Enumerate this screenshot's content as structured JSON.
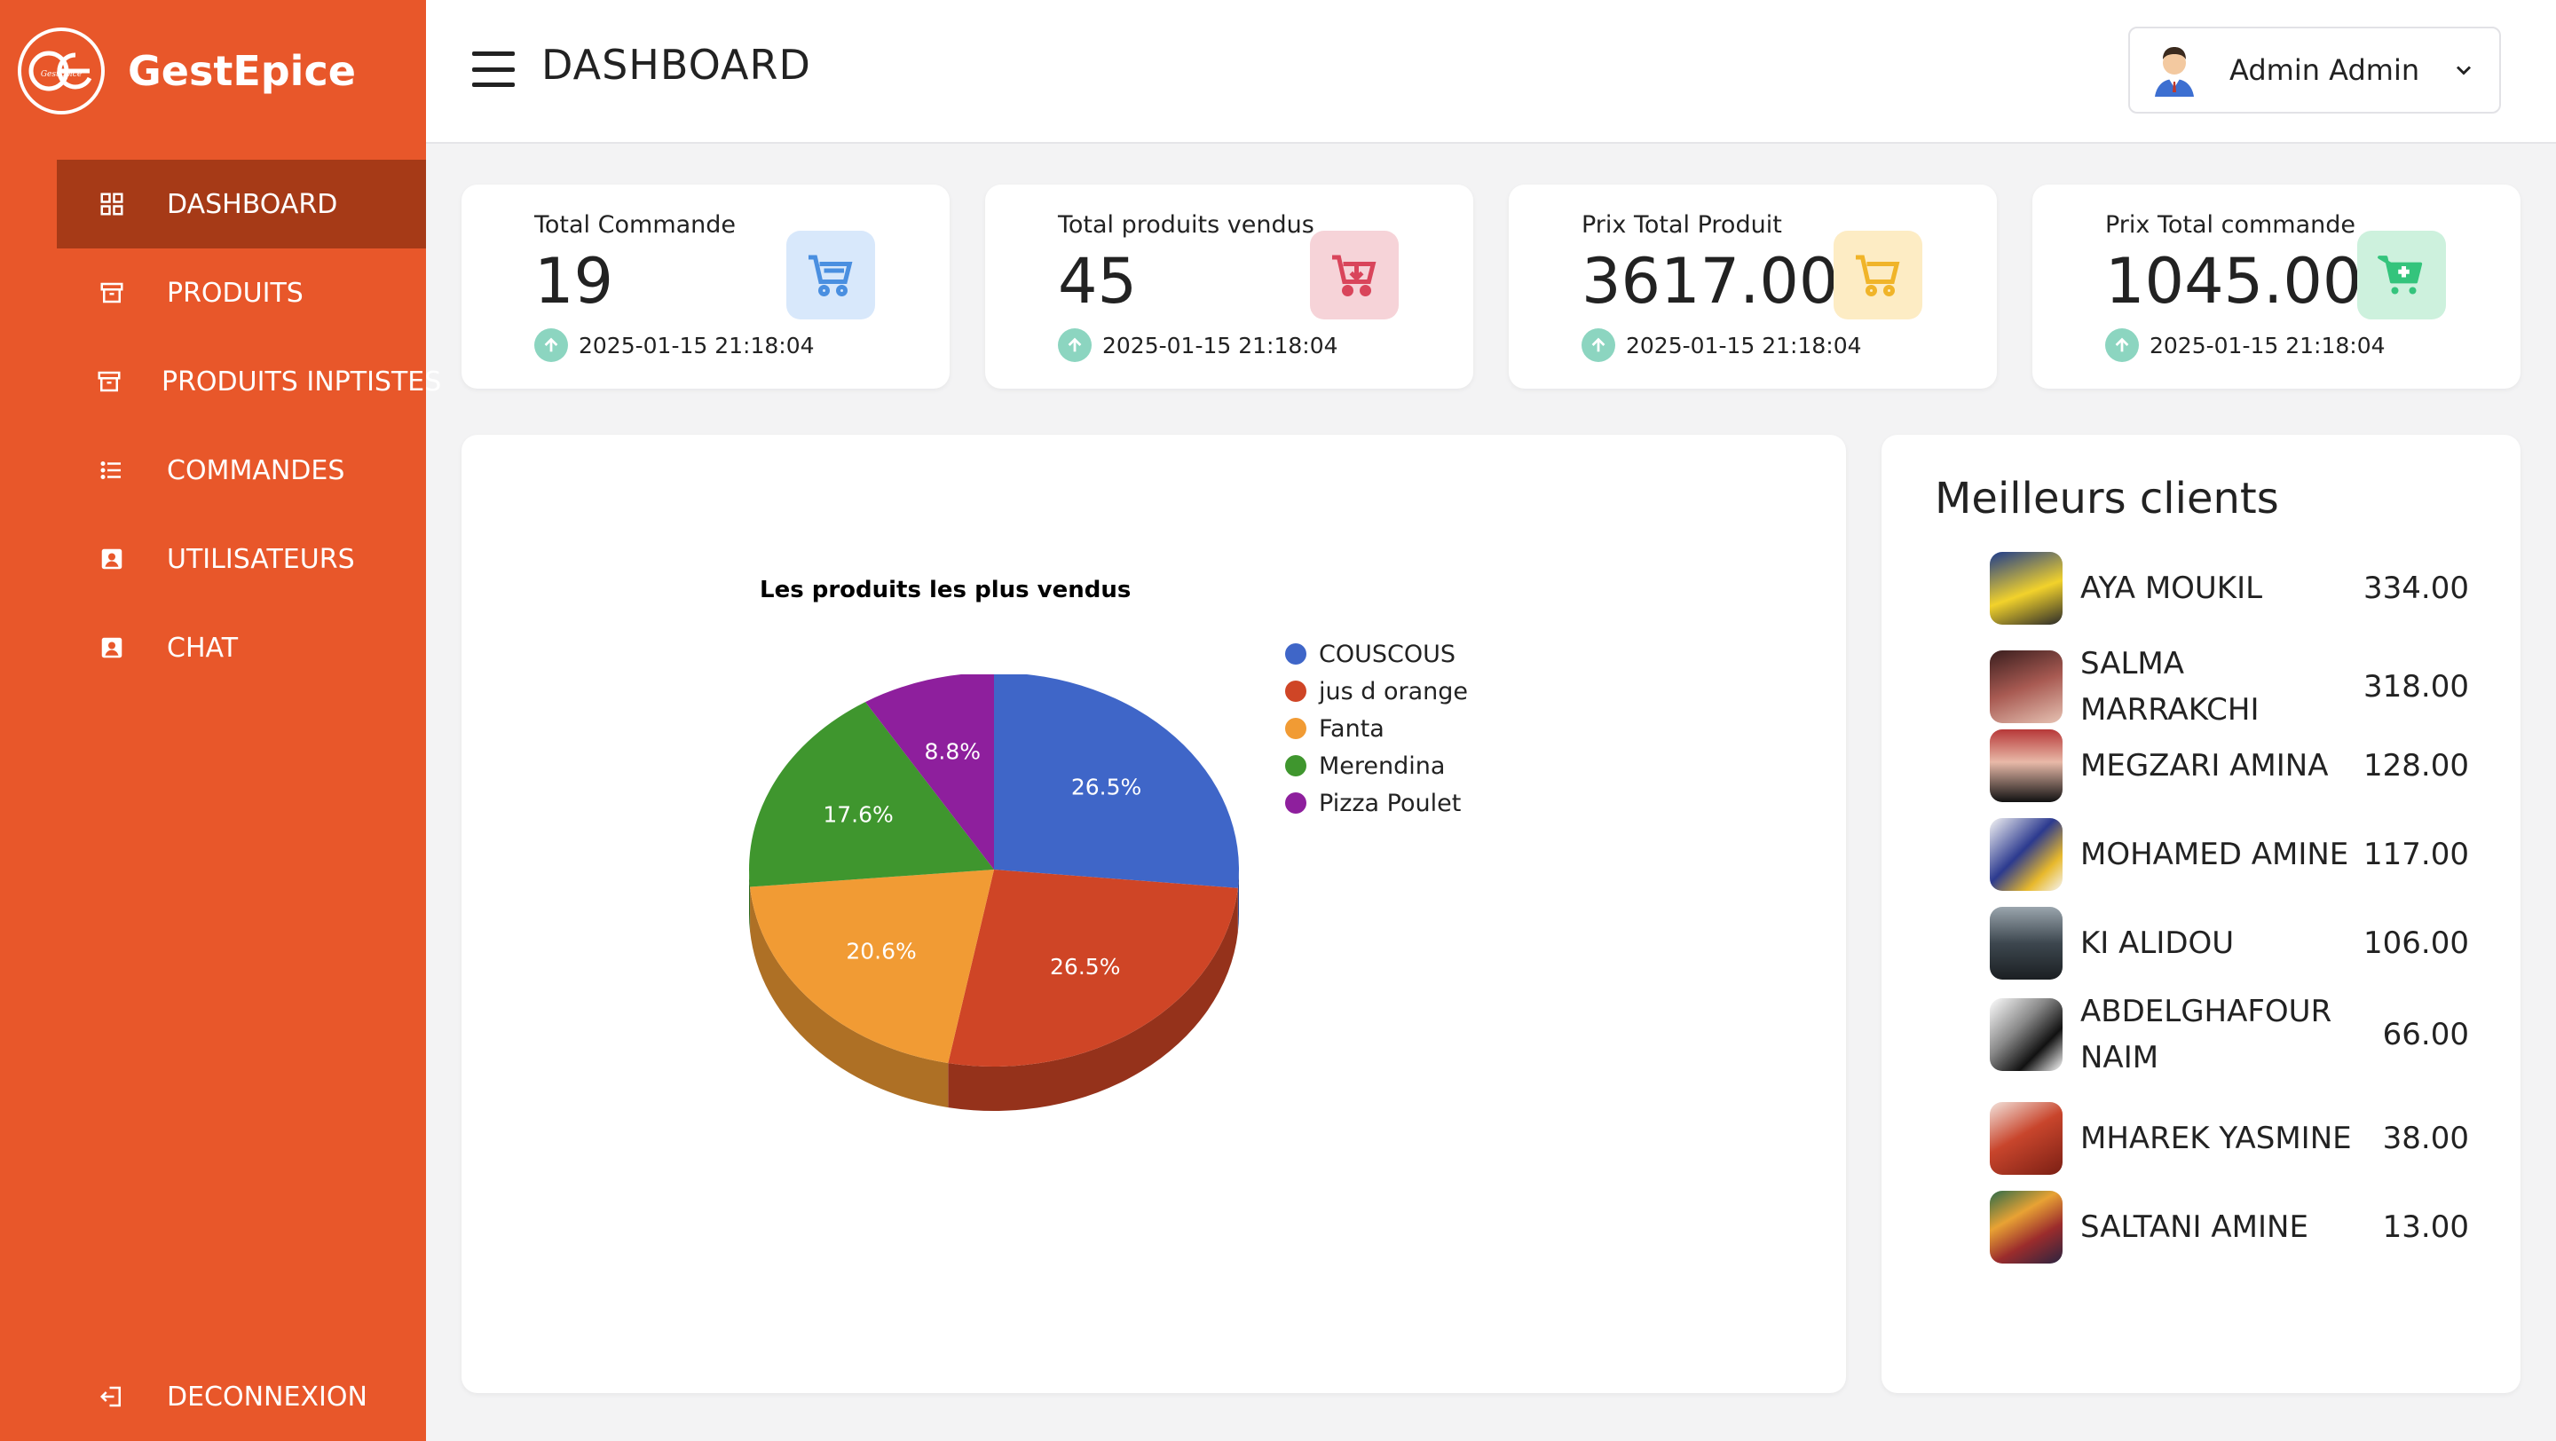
{
  "brand": {
    "name": "GestEpice",
    "logo_text": "GestEpice"
  },
  "sidebar": {
    "items": [
      {
        "label": "DASHBOARD",
        "icon": "grid-icon",
        "active": true
      },
      {
        "label": "PRODUITS",
        "icon": "archive-icon",
        "active": false
      },
      {
        "label": "PRODUITS INPTISTES",
        "icon": "archive-icon",
        "active": false
      },
      {
        "label": "COMMANDES",
        "icon": "list-icon",
        "active": false
      },
      {
        "label": "UTILISATEURS",
        "icon": "user-card-icon",
        "active": false
      },
      {
        "label": "CHAT",
        "icon": "user-card-icon",
        "active": false
      }
    ],
    "logout_label": "DECONNEXION"
  },
  "header": {
    "title": "DASHBOARD",
    "user_name": "Admin Admin"
  },
  "cards": [
    {
      "label": "Total Commande",
      "value": "19",
      "date": "2025-01-15 21:18:04",
      "icon": "cart-icon",
      "color": "#4a8fe0",
      "bg": "#d8e8fb"
    },
    {
      "label": "Total produits vendus",
      "value": "45",
      "date": "2025-01-15 21:18:04",
      "icon": "cart-download-icon",
      "color": "#d9455b",
      "bg": "#f6d3d8"
    },
    {
      "label": "Prix Total Produit",
      "value": "3617.00",
      "date": "2025-01-15 21:18:04",
      "icon": "cart-icon",
      "color": "#f0b429",
      "bg": "#fdecc4"
    },
    {
      "label": "Prix Total commande",
      "value": "1045.00",
      "date": "2025-01-15 21:18:04",
      "icon": "cart-plus-icon",
      "color": "#34c47c",
      "bg": "#cdf1dd"
    }
  ],
  "chart_data": {
    "type": "pie",
    "title": "Les produits les plus vendus",
    "legend_position": "right",
    "categories": [
      "COUSCOUS",
      "jus d orange",
      "Fanta",
      "Merendina",
      "Pizza Poulet"
    ],
    "values": [
      26.5,
      26.5,
      20.6,
      17.6,
      8.8
    ],
    "labels": [
      "26.5%",
      "26.5%",
      "20.6%",
      "17.6%",
      "8.8%"
    ],
    "colors": [
      "#3f66c8",
      "#cf4526",
      "#f19b34",
      "#3f962e",
      "#8e1f9d"
    ],
    "three_d": true
  },
  "clients": {
    "title": "Meilleurs clients",
    "items": [
      {
        "name": "AYA MOUKIL",
        "amount": "334.00"
      },
      {
        "name": "SALMA MARRAKCHI",
        "amount": "318.00"
      },
      {
        "name": "MEGZARI AMINA",
        "amount": "128.00"
      },
      {
        "name": "MOHAMED AMINE",
        "amount": "117.00"
      },
      {
        "name": "KI ALIDOU",
        "amount": "106.00"
      },
      {
        "name": "ABDELGHAFOUR NAIM",
        "amount": "66.00"
      },
      {
        "name": "MHAREK YASMINE",
        "amount": "38.00"
      },
      {
        "name": "SALTANI AMINE",
        "amount": "13.00"
      }
    ]
  }
}
